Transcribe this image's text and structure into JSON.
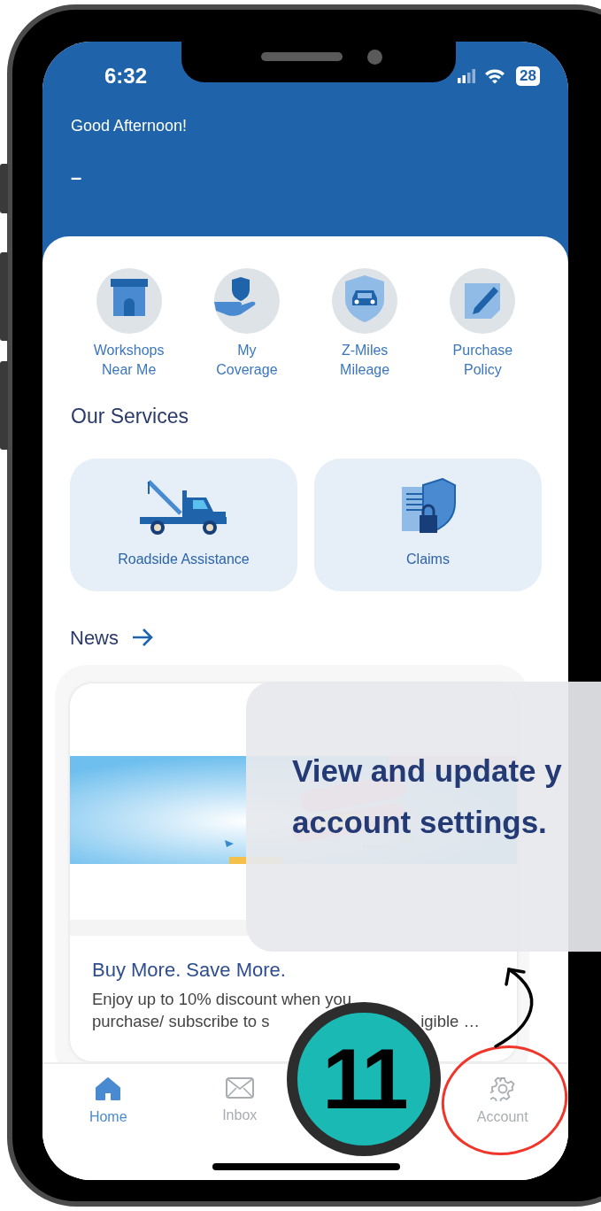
{
  "status_bar": {
    "time": "6:32",
    "battery": "28"
  },
  "header": {
    "greeting": "Good Afternoon!",
    "user_name": "–"
  },
  "quick_actions": [
    {
      "kind": "shop",
      "lines": [
        "Workshops",
        "Near Me"
      ]
    },
    {
      "kind": "coverage",
      "lines": [
        "My",
        "Coverage"
      ]
    },
    {
      "kind": "car",
      "lines": [
        "Z-Miles",
        "Mileage"
      ]
    },
    {
      "kind": "edit",
      "lines": [
        "Purchase",
        "Policy"
      ]
    }
  ],
  "services": {
    "title": "Our Services",
    "items": [
      {
        "kind": "tow",
        "label": "Roadside Assistance"
      },
      {
        "kind": "claims",
        "label": "Claims"
      }
    ]
  },
  "news": {
    "title": "News",
    "items": [
      {
        "kind": "picture",
        "title": "Buy More. Save More.",
        "description": [
          "Enjoy up to 10% discount when you",
          "purchase/ subscribe to s",
          "igible …"
        ]
      }
    ]
  },
  "bottom_nav": [
    {
      "kind": "home",
      "label": "Home",
      "selected": true
    },
    {
      "kind": "mail",
      "label": "Inbox",
      "selected": false
    },
    {
      "kind": "gear",
      "label": "Account",
      "selected": false
    }
  ],
  "tooltip": {
    "lines": [
      "View and update y",
      "account settings."
    ]
  },
  "step_badge": "11"
}
